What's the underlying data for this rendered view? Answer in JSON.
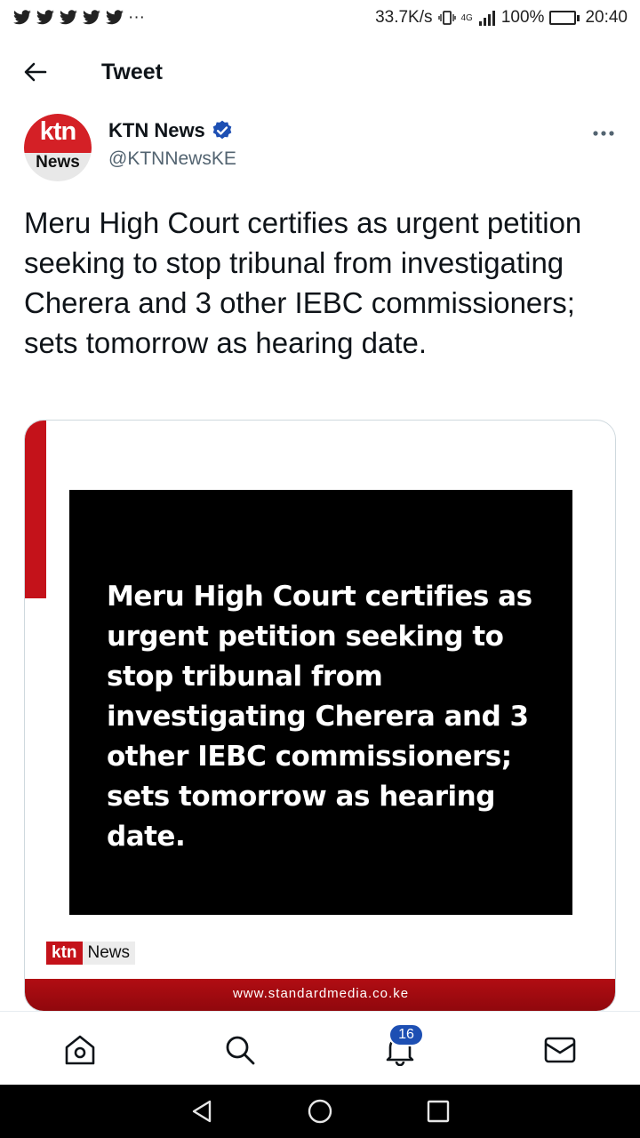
{
  "status_bar": {
    "net_speed": "33.7K/s",
    "network": "4G",
    "battery": "100%",
    "time": "20:40",
    "notification_icons": [
      "twitter-icon",
      "twitter-icon",
      "twitter-icon",
      "twitter-icon",
      "twitter-icon"
    ],
    "more": "···"
  },
  "header": {
    "title": "Tweet",
    "back_icon": "back-arrow-icon"
  },
  "author": {
    "avatar_top": "ktn",
    "avatar_bottom": "News",
    "name": "KTN News",
    "handle": "@KTNNewsKE",
    "verified": true,
    "more_icon": "more-icon"
  },
  "tweet": {
    "text": "Meru High Court certifies as urgent petition seeking to stop tribunal from investigating Cherera and 3 other IEBC commissioners; sets tomorrow as hearing date."
  },
  "media": {
    "headline": "Meru High Court certifies as urgent petition seeking to stop tribunal from investigating Cherera and 3 other IEBC commissioners; sets tomorrow as hearing date.",
    "logo_ktn": "ktn",
    "logo_news": "News",
    "footer_url": "www.standardmedia.co.ke",
    "accent_color": "#c4121a"
  },
  "bottom_nav": {
    "items": [
      "home-icon",
      "search-icon",
      "notifications-icon",
      "messages-icon"
    ],
    "notification_count": "16"
  },
  "android_nav": {
    "items": [
      "back-icon",
      "home-circle-icon",
      "recents-icon"
    ]
  }
}
